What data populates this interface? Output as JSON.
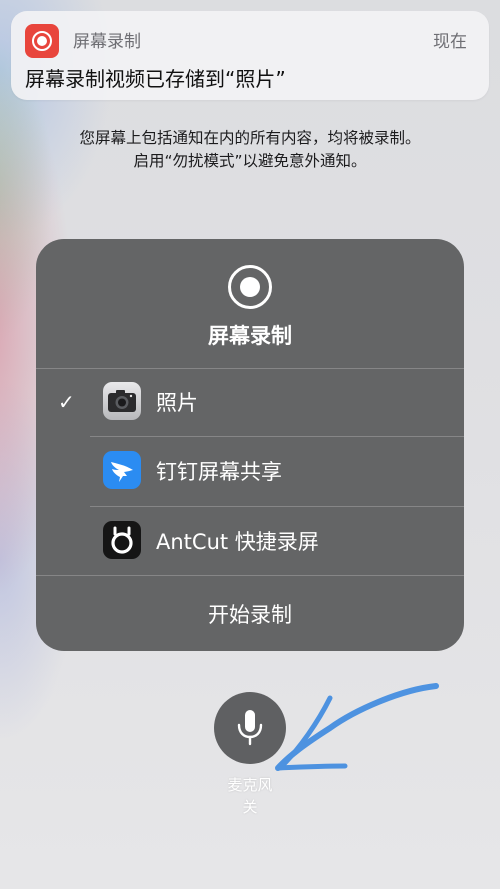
{
  "notification": {
    "app_name": "屏幕录制",
    "time": "现在",
    "message": "屏幕录制视频已存储到“照片”",
    "icon": "screen-recording-icon",
    "accent_color": "#e8453c"
  },
  "info": {
    "line1": "您屏幕上包括通知在内的所有内容，均将被录制。",
    "line2": "启用“勿扰模式”以避免意外通知。"
  },
  "panel": {
    "title": "屏幕录制",
    "record_icon": "record-icon",
    "destinations": [
      {
        "label": "照片",
        "selected": true,
        "icon": "camera-icon"
      },
      {
        "label": "钉钉屏幕共享",
        "selected": false,
        "icon": "dingtalk-icon"
      },
      {
        "label": "AntCut 快捷录屏",
        "selected": false,
        "icon": "antcut-icon"
      }
    ],
    "start_label": "开始录制",
    "check_mark": "✓"
  },
  "microphone": {
    "label_line1": "麦克风",
    "label_line2": "关",
    "icon": "microphone-icon"
  },
  "annotation": {
    "type": "hand-drawn arrow",
    "color": "#3d8ae0"
  }
}
